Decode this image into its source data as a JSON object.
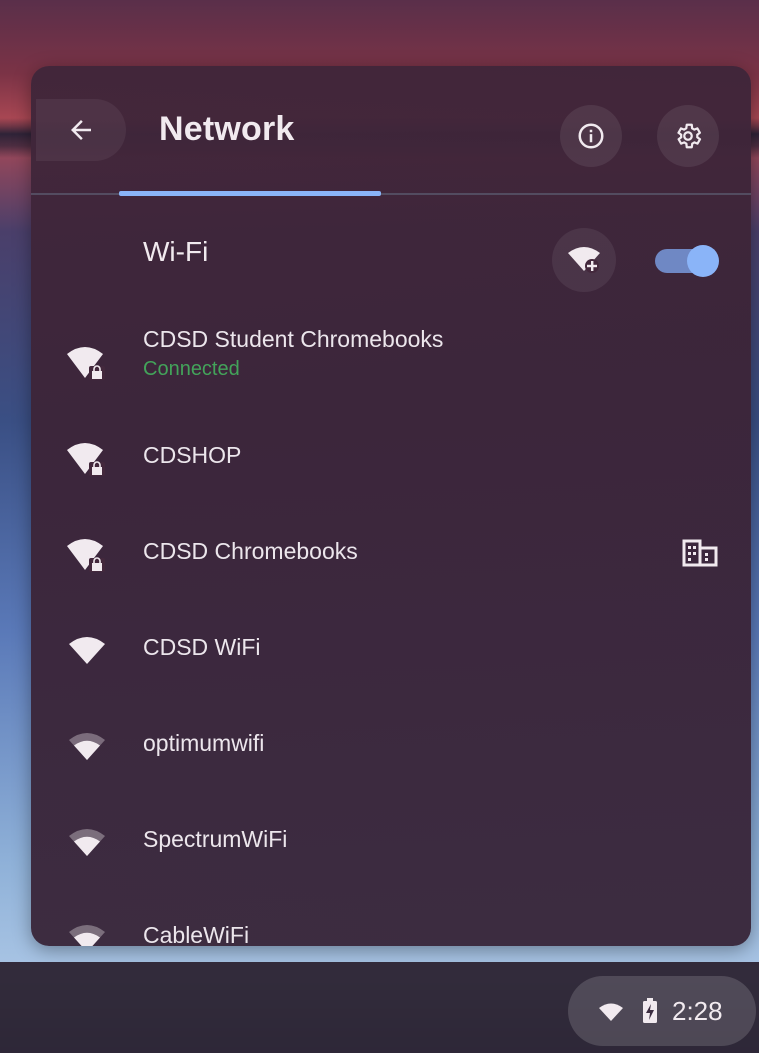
{
  "header": {
    "title": "Network",
    "back_icon": "arrow-left-icon",
    "info_icon": "info-icon",
    "settings_icon": "gear-icon"
  },
  "wifi": {
    "label": "Wi-Fi",
    "enabled": true,
    "add_icon": "add-wifi-icon"
  },
  "networks": [
    {
      "name": "CDSD Student Chromebooks",
      "status": "Connected",
      "secured": true,
      "managed": false,
      "signal": "full"
    },
    {
      "name": "CDSHOP",
      "status": "",
      "secured": true,
      "managed": false,
      "signal": "full"
    },
    {
      "name": "CDSD Chromebooks",
      "status": "",
      "secured": true,
      "managed": true,
      "signal": "full"
    },
    {
      "name": "CDSD WiFi",
      "status": "",
      "secured": false,
      "managed": false,
      "signal": "full"
    },
    {
      "name": "optimumwifi",
      "status": "",
      "secured": false,
      "managed": false,
      "signal": "partial"
    },
    {
      "name": "SpectrumWiFi",
      "status": "",
      "secured": false,
      "managed": false,
      "signal": "partial"
    },
    {
      "name": "CableWiFi",
      "status": "",
      "secured": false,
      "managed": false,
      "signal": "partial"
    }
  ],
  "tray": {
    "time": "2:28",
    "wifi_icon": "wifi-icon",
    "battery_icon": "battery-charging-icon"
  },
  "colors": {
    "accent": "#8ab4f8",
    "connected": "#43a35a"
  }
}
